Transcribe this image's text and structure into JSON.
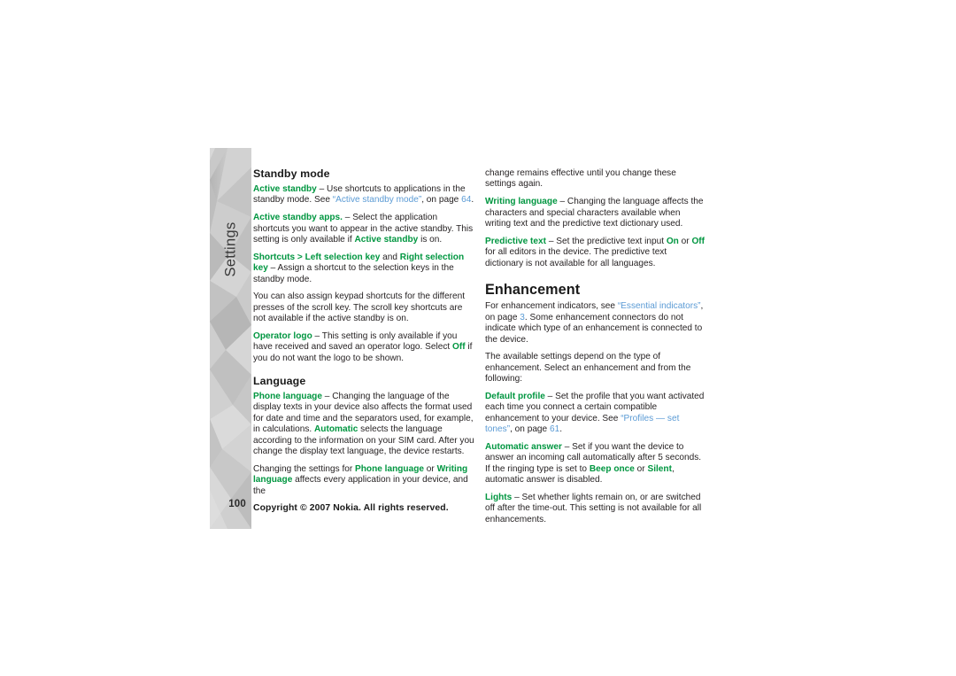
{
  "page": {
    "number": "100",
    "tab_label": "Settings",
    "copyright": "Copyright © 2007 Nokia. All rights reserved.",
    "colors": {
      "accent_green": "#009640",
      "link_blue": "#5b9bd5",
      "body_text": "#231f20",
      "tab_gray": "#c6c6c6"
    }
  },
  "left_column": {
    "heading_standby": "Standby mode",
    "p_active_standby": {
      "term": "Active standby",
      "text_1": " – Use shortcuts to applications in the standby mode. See ",
      "link": "“Active standby mode”",
      "text_2": ", on page ",
      "page_ref": "64",
      "text_3": "."
    },
    "p_active_standby_apps": {
      "term": "Active standby apps.",
      "text_1": " – Select the application shortcuts you want to appear in the active standby. This setting is only available if ",
      "term_2": "Active standby",
      "text_2": " is on."
    },
    "p_shortcuts": {
      "term": "Shortcuts",
      "sep": " > ",
      "term_2": "Left selection key",
      "conj": " and ",
      "term_3": "Right selection key",
      "text_1": " – Assign a shortcut to the selection keys in the standby mode."
    },
    "p_keypad": "You can also assign keypad shortcuts for the different presses of the scroll key. The scroll key shortcuts are not available if the active standby is on.",
    "p_operator_logo": {
      "term": "Operator logo",
      "text_1": " – This setting is only available if you have received and saved an operator logo. Select ",
      "term_2": "Off",
      "text_2": " if you do not want the logo to be shown."
    },
    "heading_language": "Language",
    "p_phone_language": {
      "term": "Phone language",
      "text_1": " – Changing the language of the display texts in your device also affects the format used for date and time and the separators used, for example, in calculations. ",
      "term_2": "Automatic",
      "text_2": " selects the language according to the information on your SIM card. After you change the display text language, the device restarts."
    },
    "p_changing": {
      "text_1": "Changing the settings for ",
      "term": "Phone language",
      "text_2": " or ",
      "term_2": "Writing language",
      "text_3": " affects every application in your device, and the"
    }
  },
  "right_column": {
    "p_change_remains": "change remains effective until you change these settings again.",
    "p_writing_language": {
      "term": "Writing language",
      "text_1": " – Changing the language affects the characters and special characters available when writing text and the predictive text dictionary used."
    },
    "p_predictive_text": {
      "term": "Predictive text",
      "text_1": " – Set the predictive text input ",
      "term_2": "On",
      "text_2": " or ",
      "term_3": "Off",
      "text_3": " for all editors in the device. The predictive text dictionary is not available for all languages."
    },
    "heading_enhancement": "Enhancement",
    "p_enhancement_indicators": {
      "text_1": "For enhancement indicators, see ",
      "link": "“Essential indicators”",
      "text_2": ", on page ",
      "page_ref": "3",
      "text_3": ". Some enhancement connectors do not indicate which type of an enhancement is connected to the device."
    },
    "p_available_settings": "The available settings depend on the type of enhancement. Select an enhancement and from the following:",
    "p_default_profile": {
      "term": "Default profile",
      "text_1": " – Set the profile that you want activated each time you connect a certain compatible enhancement to your device. See ",
      "link": "“Profiles — set tones”",
      "text_2": ", on page ",
      "page_ref": "61",
      "text_3": "."
    },
    "p_automatic_answer": {
      "term": "Automatic answer",
      "text_1": " – Set if you want the device to answer an incoming call automatically after 5 seconds. If the ringing type is set to ",
      "term_2": "Beep once",
      "text_2": " or ",
      "term_3": "Silent",
      "text_3": ", automatic answer is disabled."
    },
    "p_lights": {
      "term": "Lights",
      "text_1": " – Set whether lights remain on, or are switched off after the time-out. This setting is not available for all enhancements."
    }
  }
}
